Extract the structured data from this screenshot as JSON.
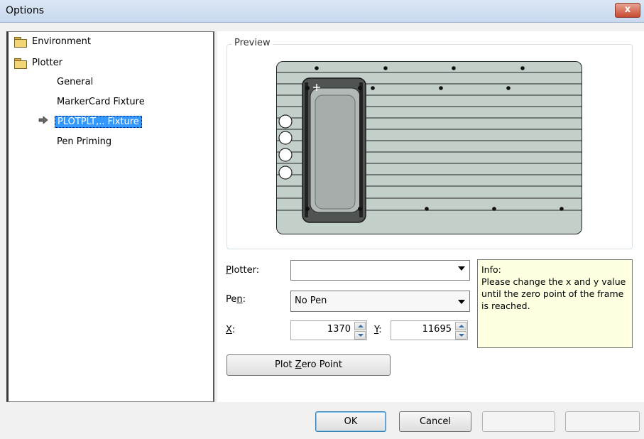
{
  "window": {
    "title": "Options",
    "close_symbol": "x"
  },
  "tree": {
    "items": [
      {
        "label": "Environment",
        "icon": "folder-icon"
      },
      {
        "label": "Plotter",
        "icon": "folder-open-icon"
      },
      {
        "label": "General"
      },
      {
        "label": "MarkerCard Fixture"
      },
      {
        "label": "PLOTPLT,.. Fixture",
        "selected": true,
        "icon": "arrow-right-icon"
      },
      {
        "label": "Pen Priming"
      }
    ]
  },
  "preview": {
    "legend": "Preview"
  },
  "form": {
    "plotter": {
      "label_accel": "P",
      "label_rest": "lotter:",
      "value": ""
    },
    "pen": {
      "label_pre": "Pe",
      "label_accel": "n",
      "label_post": ":",
      "value": "No Pen"
    },
    "x": {
      "label_accel": "X",
      "label_rest": ":",
      "value": "1370"
    },
    "y": {
      "label_accel": "Y",
      "label_rest": ":",
      "value": "11695"
    }
  },
  "info": {
    "heading": "Info:",
    "text": "Please change the x and y value until the zero point of the frame is reached."
  },
  "buttons": {
    "plot_zero_pre": "Plot ",
    "plot_zero_accel": "Z",
    "plot_zero_post": "ero Point",
    "ok": "OK",
    "cancel": "Cancel"
  },
  "colors": {
    "selection": "#3399ff",
    "info_bg": "#ffffe1",
    "board": "#c3d0ca",
    "fixture": "#4f5452"
  }
}
